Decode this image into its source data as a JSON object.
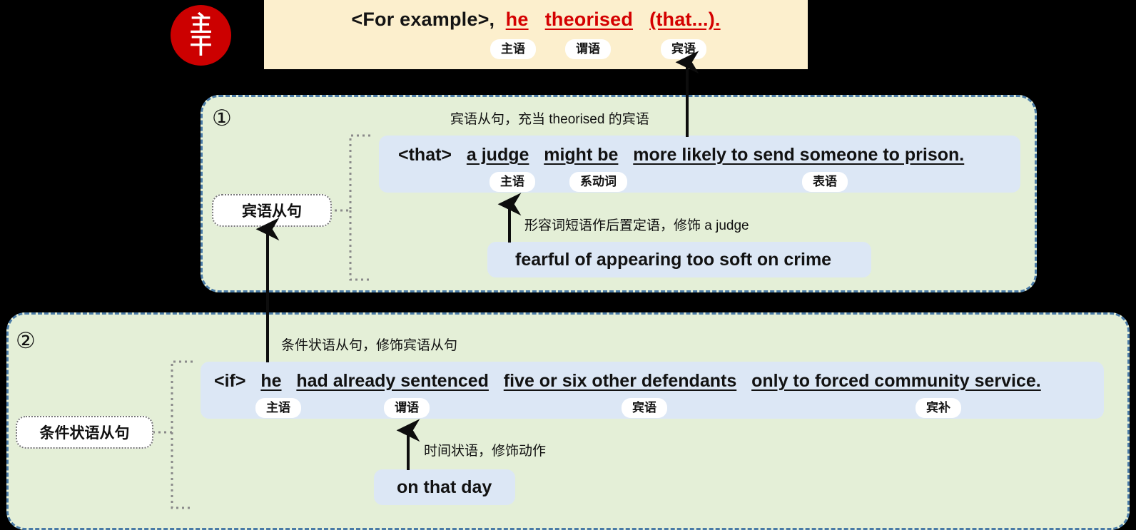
{
  "badge": {
    "char_top": "主",
    "char_bottom": "干",
    "color": "#CC0000"
  },
  "topbar": {
    "bg": "#FCEFCD",
    "text_parts": {
      "adverbial": "<For example>,",
      "subject": "he",
      "predicate": "theorised",
      "object": "(that...)."
    },
    "pills": [
      {
        "label": "主语"
      },
      {
        "label": "谓语"
      },
      {
        "label": "宾语"
      }
    ]
  },
  "panel1": {
    "number": "①",
    "chip_label": "宾语从句",
    "note_top": "宾语从句，充当 theorised 的宾语",
    "sentence": {
      "connector": "<that>",
      "parts": [
        {
          "text": "a judge",
          "underline": true,
          "pill": "主语"
        },
        {
          "text": "might be",
          "underline": true,
          "pill": "系动词"
        },
        {
          "text": "more likely to send someone to prison.",
          "underline": true,
          "pill": "表语"
        }
      ]
    },
    "modifier": {
      "note": "形容词短语作后置定语，修饰 a judge",
      "text": "fearful of appearing too soft on crime"
    }
  },
  "panel2": {
    "number": "②",
    "chip_label": "条件状语从句",
    "note_top": "条件状语从句，修饰宾语从句",
    "sentence": {
      "connector": "<if>",
      "parts": [
        {
          "text": "he",
          "underline": true,
          "pill": "主语"
        },
        {
          "text": "had already sentenced",
          "underline": true,
          "pill": "谓语"
        },
        {
          "text": "five or six other defendants",
          "underline": true,
          "pill": "宾语"
        },
        {
          "text": "only to forced community service.",
          "underline": true,
          "pill": "宾补"
        }
      ]
    },
    "modifier": {
      "note": "时间状语，修饰动作",
      "text": "on that day"
    }
  },
  "colors": {
    "panel_bg": "#E4EFD7",
    "panel_border": "#4A7BA7",
    "sentence_bg": "#DCE7F5",
    "accent_red": "#D40000",
    "topbar_bg": "#FCEFCD"
  }
}
